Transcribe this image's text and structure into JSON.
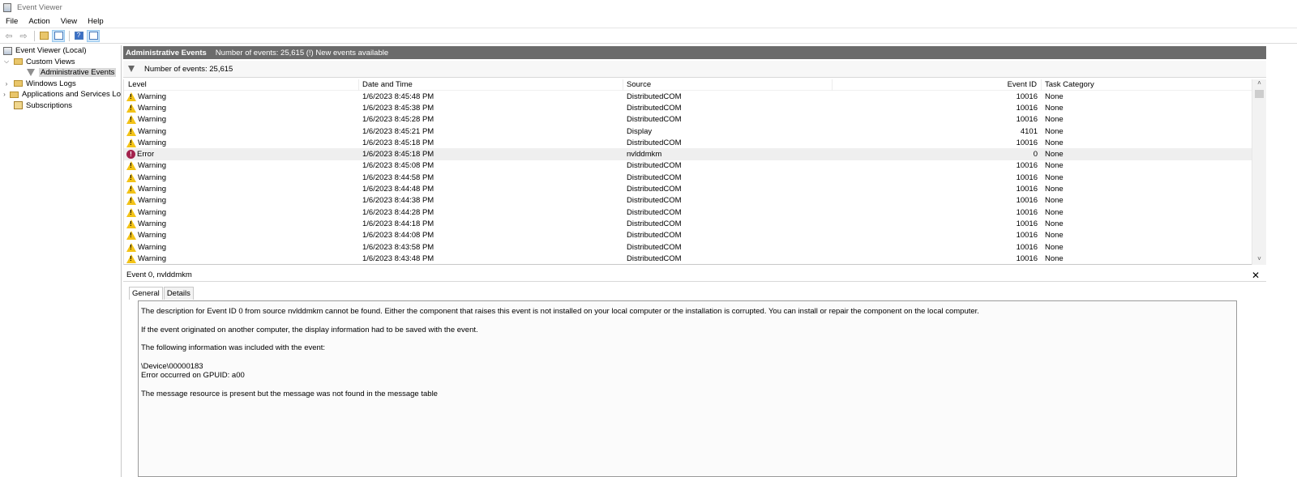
{
  "window": {
    "title": "Event Viewer"
  },
  "menu": [
    "File",
    "Action",
    "View",
    "Help"
  ],
  "toolbar": {
    "buttons": [
      "back-icon",
      "forward-icon",
      "folder-icon",
      "view-icon",
      "help-icon",
      "properties-icon"
    ]
  },
  "tree": {
    "root": "Event Viewer (Local)",
    "custom_views": "Custom Views",
    "admin_events": "Administrative Events",
    "windows_logs": "Windows Logs",
    "apps_services": "Applications and Services Lo",
    "subscriptions": "Subscriptions"
  },
  "header": {
    "title": "Administrative Events",
    "info": "Number of events: 25,615 (!) New events available"
  },
  "filter": {
    "text": "Number of events: 25,615"
  },
  "grid": {
    "columns": [
      "Level",
      "Date and Time",
      "Source",
      "Event ID",
      "Task Category"
    ],
    "rows": [
      {
        "level": "Warning",
        "date": "1/6/2023 8:45:48 PM",
        "source": "DistributedCOM",
        "id": "10016",
        "cat": "None"
      },
      {
        "level": "Warning",
        "date": "1/6/2023 8:45:38 PM",
        "source": "DistributedCOM",
        "id": "10016",
        "cat": "None"
      },
      {
        "level": "Warning",
        "date": "1/6/2023 8:45:28 PM",
        "source": "DistributedCOM",
        "id": "10016",
        "cat": "None"
      },
      {
        "level": "Warning",
        "date": "1/6/2023 8:45:21 PM",
        "source": "Display",
        "id": "4101",
        "cat": "None"
      },
      {
        "level": "Warning",
        "date": "1/6/2023 8:45:18 PM",
        "source": "DistributedCOM",
        "id": "10016",
        "cat": "None"
      },
      {
        "level": "Error",
        "date": "1/6/2023 8:45:18 PM",
        "source": "nvlddmkm",
        "id": "0",
        "cat": "None"
      },
      {
        "level": "Warning",
        "date": "1/6/2023 8:45:08 PM",
        "source": "DistributedCOM",
        "id": "10016",
        "cat": "None"
      },
      {
        "level": "Warning",
        "date": "1/6/2023 8:44:58 PM",
        "source": "DistributedCOM",
        "id": "10016",
        "cat": "None"
      },
      {
        "level": "Warning",
        "date": "1/6/2023 8:44:48 PM",
        "source": "DistributedCOM",
        "id": "10016",
        "cat": "None"
      },
      {
        "level": "Warning",
        "date": "1/6/2023 8:44:38 PM",
        "source": "DistributedCOM",
        "id": "10016",
        "cat": "None"
      },
      {
        "level": "Warning",
        "date": "1/6/2023 8:44:28 PM",
        "source": "DistributedCOM",
        "id": "10016",
        "cat": "None"
      },
      {
        "level": "Warning",
        "date": "1/6/2023 8:44:18 PM",
        "source": "DistributedCOM",
        "id": "10016",
        "cat": "None"
      },
      {
        "level": "Warning",
        "date": "1/6/2023 8:44:08 PM",
        "source": "DistributedCOM",
        "id": "10016",
        "cat": "None"
      },
      {
        "level": "Warning",
        "date": "1/6/2023 8:43:58 PM",
        "source": "DistributedCOM",
        "id": "10016",
        "cat": "None"
      },
      {
        "level": "Warning",
        "date": "1/6/2023 8:43:48 PM",
        "source": "DistributedCOM",
        "id": "10016",
        "cat": "None"
      }
    ]
  },
  "detail": {
    "title": "Event 0, nvlddmkm",
    "tabs": [
      "General",
      "Details"
    ],
    "p1": "The description for Event ID 0 from source nvlddmkm cannot be found. Either the component that raises this event is not installed on your local computer or the installation is corrupted. You can install or repair the component on the local computer.",
    "p2": "If the event originated on another computer, the display information had to be saved with the event.",
    "p3": "The following information was included with the event:",
    "p4a": "\\Device\\00000183",
    "p4b": "Error occurred on GPUID: a00",
    "p5": "The message resource is present but the message was not found in the message table"
  },
  "colors": {
    "header_bar": "#6b6b6b",
    "warning": "#f3c317",
    "error": "#a3224d",
    "selection": "#efefef"
  }
}
